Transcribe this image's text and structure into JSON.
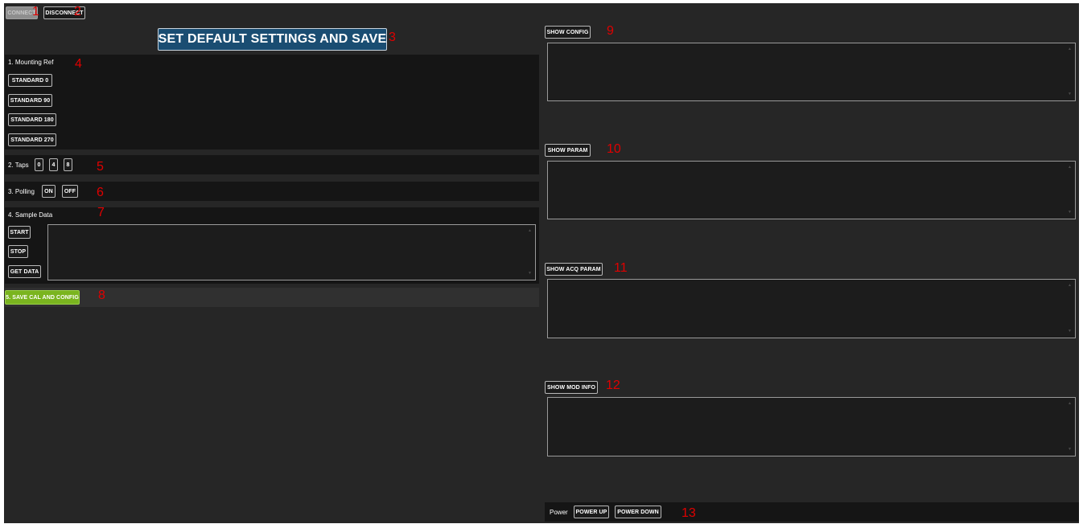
{
  "toolbar": {
    "connect": "CONNECT",
    "disconnect": "DISCONNECT"
  },
  "default_button": "SET DEFAULT SETTINGS AND SAVE",
  "mounting": {
    "title": "1. Mounting Ref",
    "buttons": [
      "STANDARD 0",
      "STANDARD 90",
      "STANDARD 180",
      "STANDARD 270"
    ]
  },
  "taps": {
    "title": "2. Taps",
    "buttons": [
      "0",
      "4",
      "8"
    ]
  },
  "polling": {
    "title": "3. Polling",
    "on": "ON",
    "off": "OFF"
  },
  "sample": {
    "title": "4. Sample Data",
    "start": "START",
    "stop": "STOP",
    "get_data": "GET DATA"
  },
  "save_button": "5. SAVE CAL AND CONFIG",
  "right": {
    "show_config": "SHOW CONFIG",
    "show_param": "SHOW PARAM",
    "show_acq_param": "SHOW ACQ PARAM",
    "show_mod_info": "SHOW MOD INFO"
  },
  "power": {
    "label": "Power",
    "up": "POWER UP",
    "down": "POWER DOWN"
  },
  "markers": [
    "1",
    "2",
    "3",
    "4",
    "5",
    "6",
    "7",
    "8",
    "9",
    "10",
    "11",
    "12",
    "13"
  ],
  "colors": {
    "background": "#262626",
    "panel": "#151515",
    "accent_blue": "#1a4d72",
    "accent_green": "#7ab41f",
    "marker_red": "#e00000"
  }
}
